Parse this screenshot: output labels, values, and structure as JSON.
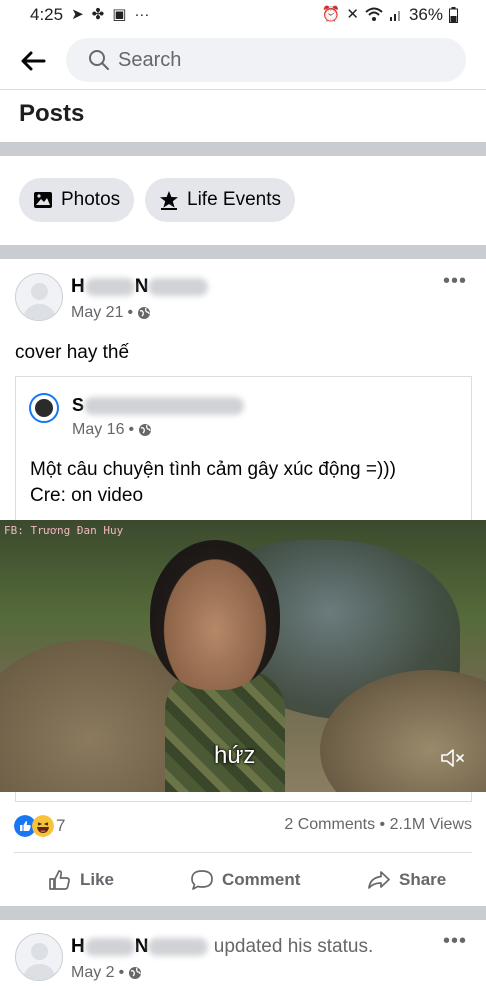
{
  "status_bar": {
    "time": "4:25",
    "battery": "36%",
    "more_glyph": "···"
  },
  "search": {
    "placeholder": "Search"
  },
  "section_title": "Posts",
  "filters": [
    {
      "label": "Photos",
      "icon": "photos-icon"
    },
    {
      "label": "Life Events",
      "icon": "star-flag-icon"
    }
  ],
  "post": {
    "author_visible": "H",
    "author_visible_2": "N",
    "date": "May 21",
    "privacy_icon": "globe-icon",
    "caption": "cover hay thế",
    "shared": {
      "page_initial": "S",
      "date": "May 16",
      "text_line1": "Một câu chuyện tình cảm gây xúc động =)))",
      "text_line2": "Cre: on video",
      "video": {
        "watermark": "FB: Trương Đan Huy",
        "subtitle": "hứz",
        "muted": true
      }
    },
    "reaction_count": "7",
    "comments": "2 Comments",
    "views": "2.1M Views",
    "separator": "•",
    "actions": {
      "like": "Like",
      "comment": "Comment",
      "share": "Share"
    }
  },
  "next_post": {
    "author_visible": "H",
    "author_visible_2": "N",
    "status_text": "updated his status.",
    "date": "May 2"
  },
  "colors": {
    "accent": "#1877f2",
    "divider_band": "#c9ccd1",
    "chip_bg": "#e4e6eb",
    "meta_text": "#65676b"
  }
}
